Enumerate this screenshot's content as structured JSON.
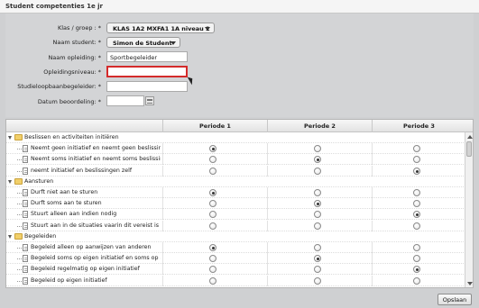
{
  "window": {
    "title": "Student competenties 1e jr"
  },
  "form": {
    "klas": {
      "label": "Klas / groep :",
      "value": "KLAS 1A2 MXFA1 1A niveau 2"
    },
    "student": {
      "label": "Naam student:",
      "value": "Simon de Student"
    },
    "opleiding": {
      "label": "Naam opleiding:",
      "value": "Sportbegeleider"
    },
    "niveau": {
      "label": "Opleidingsniveau:",
      "value": ""
    },
    "slb": {
      "label": "Studieloopbaanbegeleider:",
      "value": ""
    },
    "datum": {
      "label": "Datum beoordeling:",
      "value": ""
    },
    "required_mark": "*"
  },
  "grid": {
    "columns": [
      "Periode 1",
      "Periode 2",
      "Periode 3"
    ],
    "groups": [
      {
        "label": "Beslissen en activiteiten initiëren",
        "items": [
          {
            "label": "Neemt geen initiatief en neemt geen beslissingen",
            "selected": 1
          },
          {
            "label": "Neemt soms initiatief en neemt soms beslissingen zelf",
            "selected": 2
          },
          {
            "label": "neemt initiatief en beslissingen zelf",
            "selected": 3
          }
        ]
      },
      {
        "label": "Aansturen",
        "items": [
          {
            "label": "Durft niet aan te sturen",
            "selected": 1
          },
          {
            "label": "Durft soms aan te sturen",
            "selected": 2
          },
          {
            "label": "Stuurt alleen aan indien nodig",
            "selected": 3
          },
          {
            "label": "Stuurt aan in de situaties vaarin dit vereist is",
            "selected": 0
          }
        ]
      },
      {
        "label": "Begeleiden",
        "items": [
          {
            "label": "Begeleid alleen op aanwijzen van anderen",
            "selected": 1
          },
          {
            "label": "Begeleid soms op eigen initiatief en soms op aanwijzen",
            "selected": 2
          },
          {
            "label": "Begeleid regelmatig op eigen initiatief",
            "selected": 3
          },
          {
            "label": "Begeleid op eigen initiatief",
            "selected": 0
          }
        ]
      }
    ]
  },
  "footer": {
    "save_label": "Opslaan"
  },
  "colors": {
    "error_border": "#d42b2b",
    "folder": "#f1cf6a"
  }
}
